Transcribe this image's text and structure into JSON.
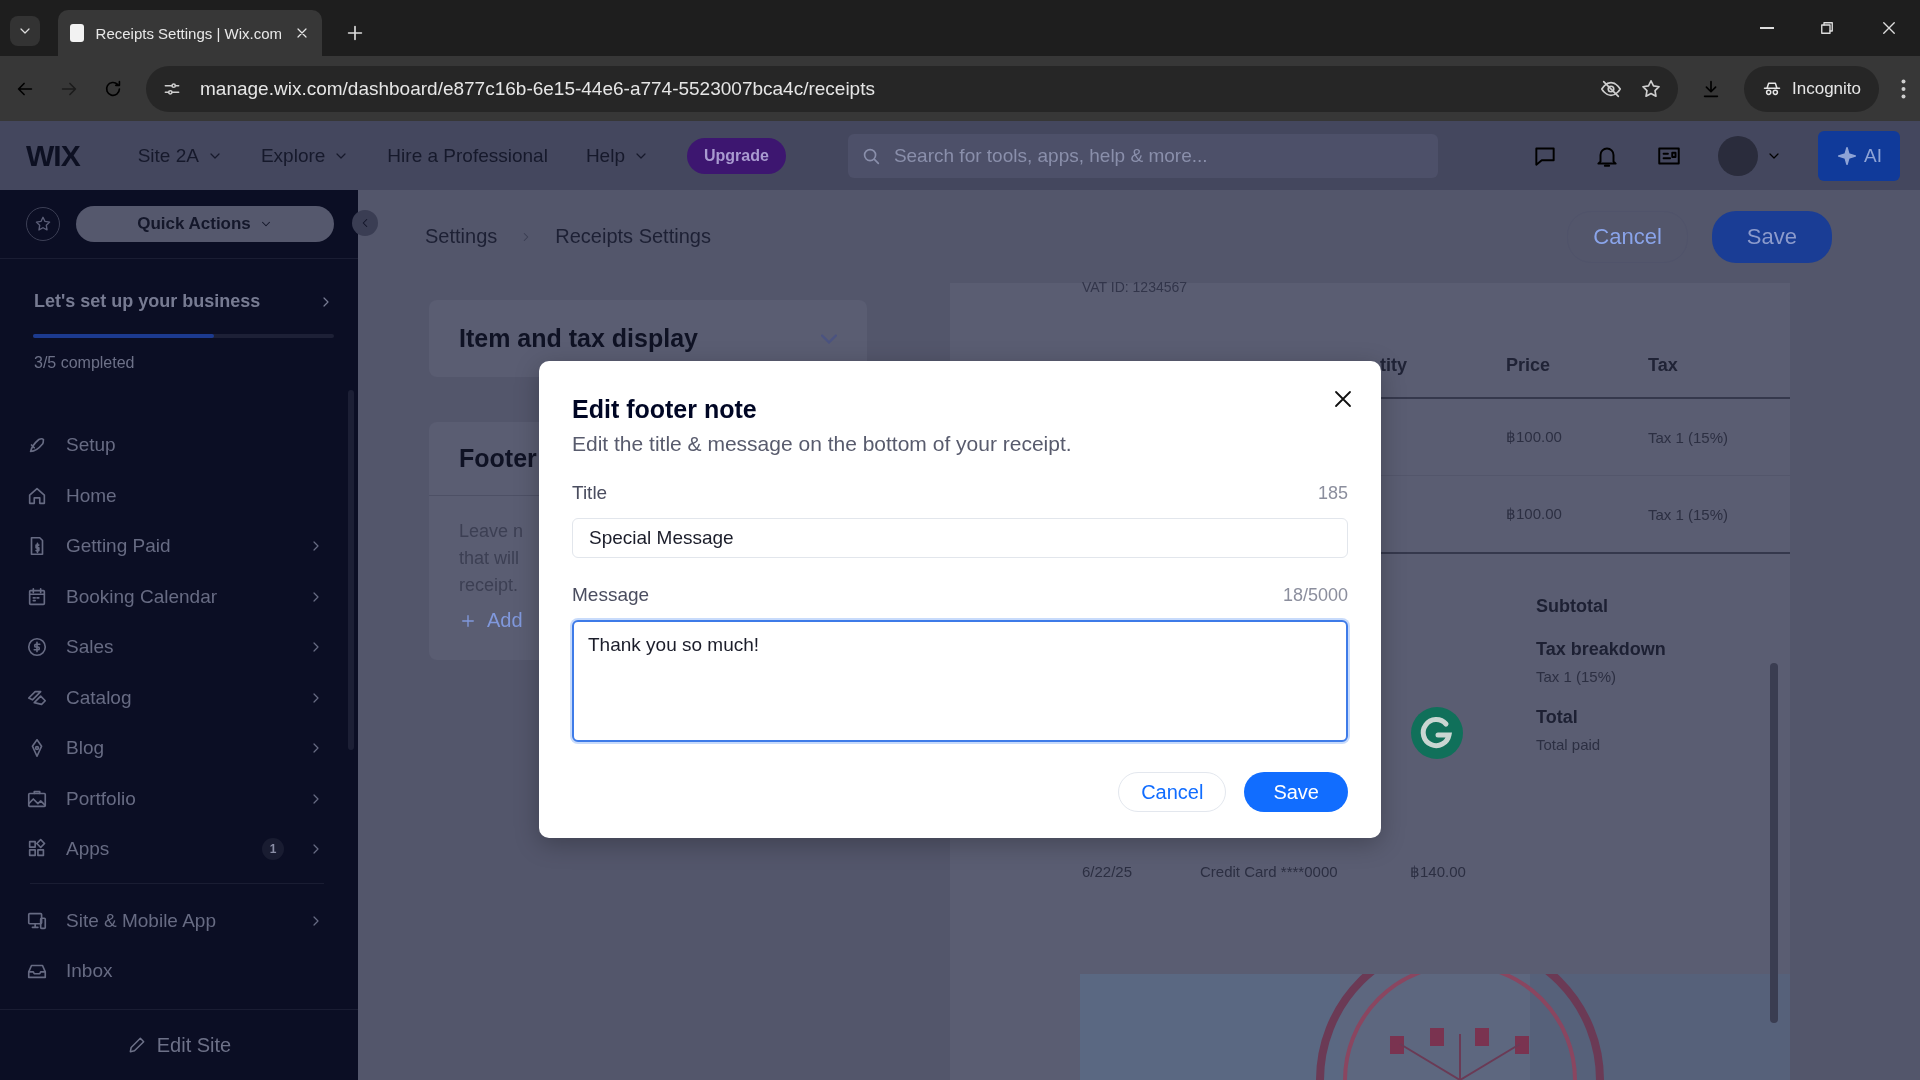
{
  "browser": {
    "tab_title": "Receipts Settings | Wix.com",
    "url": "manage.wix.com/dashboard/e877c16b-6e15-44e6-a774-5523007bca4c/receipts",
    "profile": "Incognito"
  },
  "topbar": {
    "logo": "WIX",
    "menus": [
      {
        "label": "Site 2A",
        "dropdown": true
      },
      {
        "label": "Explore",
        "dropdown": true
      },
      {
        "label": "Hire a Professional",
        "dropdown": false
      },
      {
        "label": "Help",
        "dropdown": true
      }
    ],
    "upgrade": "Upgrade",
    "search_placeholder": "Search for tools, apps, help & more...",
    "ai_button": "AI"
  },
  "sidebar": {
    "quick_actions": "Quick Actions",
    "setup": {
      "title": "Let's set up your business",
      "level": 0.6,
      "progress": "3/5 completed"
    },
    "items": [
      {
        "label": "Setup",
        "expandable": false
      },
      {
        "label": "Home",
        "expandable": false
      },
      {
        "label": "Getting Paid",
        "expandable": true
      },
      {
        "label": "Booking Calendar",
        "expandable": true
      },
      {
        "label": "Sales",
        "expandable": true
      },
      {
        "label": "Catalog",
        "expandable": true
      },
      {
        "label": "Blog",
        "expandable": true
      },
      {
        "label": "Portfolio",
        "expandable": true
      },
      {
        "label": "Apps",
        "expandable": true,
        "badge": "1"
      }
    ],
    "more_items": [
      {
        "label": "Site & Mobile App",
        "expandable": true
      },
      {
        "label": "Inbox",
        "expandable": false
      }
    ],
    "edit_site": "Edit Site"
  },
  "header": {
    "breadcrumbs": [
      "Settings",
      "Receipts Settings"
    ],
    "cancel": "Cancel",
    "save": "Save"
  },
  "settings_cards": [
    {
      "title": "Item and tax display"
    },
    {
      "title": "Footer",
      "lines": [
        "Leave n",
        "that will",
        "receipt."
      ],
      "add": "Add"
    }
  ],
  "receipt": {
    "vat": "VAT ID: 1234567",
    "columns": [
      "tity",
      "Price",
      "Tax"
    ],
    "rows": [
      [
        "",
        "฿100.00",
        "Tax 1 (15%)"
      ],
      [
        "",
        "฿100.00",
        "Tax 1 (15%)"
      ]
    ],
    "summary": [
      {
        "label": "Subtotal"
      },
      {
        "label": "Tax breakdown",
        "detail": "Tax 1 (15%)"
      },
      {
        "label": "Total",
        "detail": "Total paid"
      }
    ],
    "payment": [
      "6/22/25",
      "Credit Card ****0000",
      "฿140.00"
    ]
  },
  "modal": {
    "title": "Edit footer note",
    "subtitle": "Edit the title & message on the bottom of your receipt.",
    "fields": [
      {
        "kind": "input",
        "label": "Title",
        "counter": "185",
        "value": "Special Message",
        "focused": false
      },
      {
        "kind": "textarea",
        "label": "Message",
        "counter": "18/5000",
        "value": "Thank you so much!",
        "focused": true
      }
    ],
    "cancel": "Cancel",
    "save": "Save"
  }
}
